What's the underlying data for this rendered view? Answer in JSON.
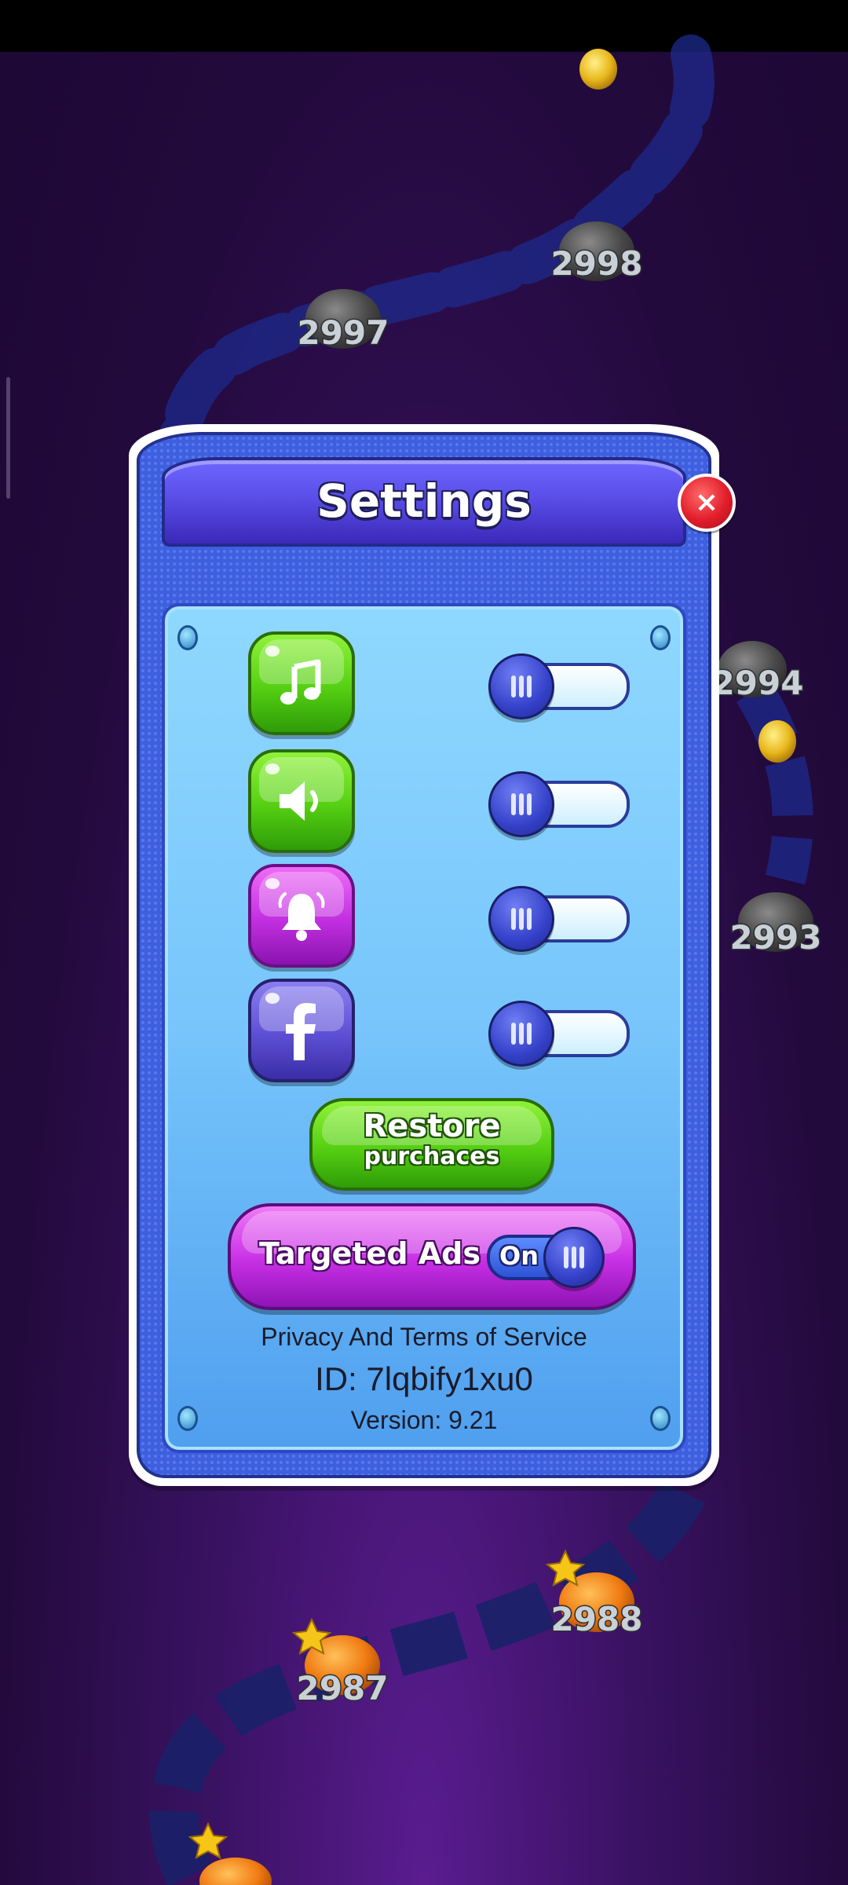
{
  "settings": {
    "title": "Settings",
    "close_symbol": "×",
    "toggles": [
      {
        "icon": "music-note-icon",
        "enabled": false
      },
      {
        "icon": "speaker-icon",
        "enabled": false
      },
      {
        "icon": "bell-icon",
        "enabled": false
      },
      {
        "icon": "facebook-icon",
        "enabled": false
      }
    ],
    "restore_line1": "Restore",
    "restore_line2": "purchaces",
    "targeted_ads_label": "Targeted Ads",
    "targeted_ads_state": "On",
    "privacy_link": "Privacy And  Terms of Service",
    "id_text": "ID: 7lqbify1xu0",
    "version_text": "Version: 9.21"
  },
  "map": {
    "levels": [
      "2998",
      "2997",
      "2994",
      "2993",
      "2988",
      "2987"
    ]
  },
  "colors": {
    "panel_blue": "#3d5fe0",
    "button_green": "#55cf12",
    "button_magenta": "#c12fe0",
    "close_red": "#e21d2b"
  }
}
